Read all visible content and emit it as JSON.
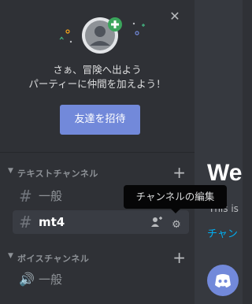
{
  "welcome": {
    "line1": "さぁ、冒険へ出よう",
    "line2": "パーティーに仲間を加えよう！",
    "invite_label": "友達を招待"
  },
  "categories": [
    {
      "label": "テキストチャンネル"
    },
    {
      "label": "ボイスチャンネル"
    }
  ],
  "channels": [
    {
      "icon": "#",
      "name": "一般"
    },
    {
      "icon": "#",
      "name": "mt4"
    },
    {
      "icon": "🔊",
      "name": "一般"
    }
  ],
  "tooltip": {
    "text": "チャンネルの編集"
  },
  "chat": {
    "title": "We",
    "subtitle": "This is",
    "link": "チャン"
  },
  "colors": {
    "accent": "#7289da",
    "sidebar_bg": "#2f3136",
    "chat_bg": "#36393f",
    "link": "#00b0f4",
    "badge_green": "#3ba55c"
  },
  "icons": {
    "close": "close-icon",
    "add": "plus-icon",
    "add_member": "add-member-icon",
    "settings": "gear-icon"
  }
}
